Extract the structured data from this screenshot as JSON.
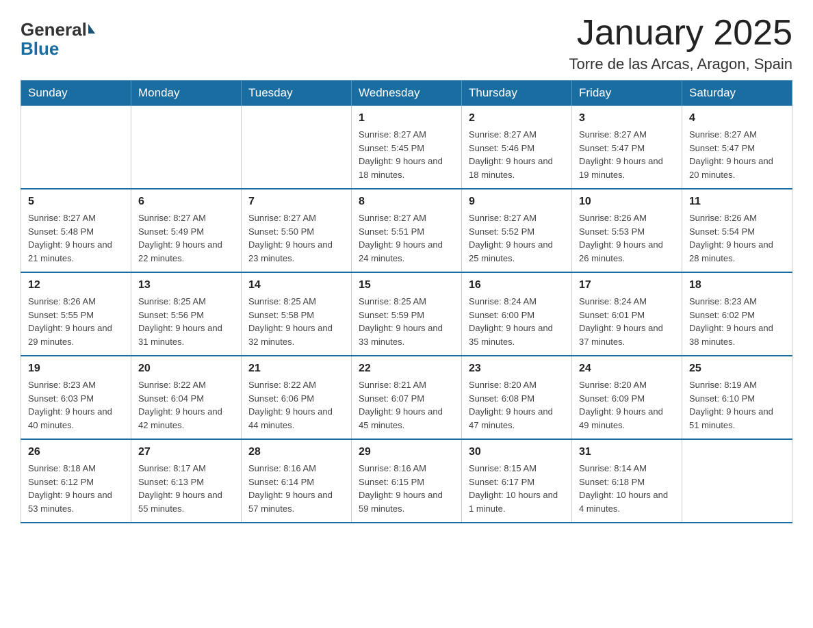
{
  "header": {
    "logo": {
      "general": "General",
      "blue": "Blue"
    },
    "title": "January 2025",
    "subtitle": "Torre de las Arcas, Aragon, Spain"
  },
  "calendar": {
    "weekdays": [
      "Sunday",
      "Monday",
      "Tuesday",
      "Wednesday",
      "Thursday",
      "Friday",
      "Saturday"
    ],
    "weeks": [
      [
        {
          "day": "",
          "info": ""
        },
        {
          "day": "",
          "info": ""
        },
        {
          "day": "",
          "info": ""
        },
        {
          "day": "1",
          "info": "Sunrise: 8:27 AM\nSunset: 5:45 PM\nDaylight: 9 hours and 18 minutes."
        },
        {
          "day": "2",
          "info": "Sunrise: 8:27 AM\nSunset: 5:46 PM\nDaylight: 9 hours and 18 minutes."
        },
        {
          "day": "3",
          "info": "Sunrise: 8:27 AM\nSunset: 5:47 PM\nDaylight: 9 hours and 19 minutes."
        },
        {
          "day": "4",
          "info": "Sunrise: 8:27 AM\nSunset: 5:47 PM\nDaylight: 9 hours and 20 minutes."
        }
      ],
      [
        {
          "day": "5",
          "info": "Sunrise: 8:27 AM\nSunset: 5:48 PM\nDaylight: 9 hours and 21 minutes."
        },
        {
          "day": "6",
          "info": "Sunrise: 8:27 AM\nSunset: 5:49 PM\nDaylight: 9 hours and 22 minutes."
        },
        {
          "day": "7",
          "info": "Sunrise: 8:27 AM\nSunset: 5:50 PM\nDaylight: 9 hours and 23 minutes."
        },
        {
          "day": "8",
          "info": "Sunrise: 8:27 AM\nSunset: 5:51 PM\nDaylight: 9 hours and 24 minutes."
        },
        {
          "day": "9",
          "info": "Sunrise: 8:27 AM\nSunset: 5:52 PM\nDaylight: 9 hours and 25 minutes."
        },
        {
          "day": "10",
          "info": "Sunrise: 8:26 AM\nSunset: 5:53 PM\nDaylight: 9 hours and 26 minutes."
        },
        {
          "day": "11",
          "info": "Sunrise: 8:26 AM\nSunset: 5:54 PM\nDaylight: 9 hours and 28 minutes."
        }
      ],
      [
        {
          "day": "12",
          "info": "Sunrise: 8:26 AM\nSunset: 5:55 PM\nDaylight: 9 hours and 29 minutes."
        },
        {
          "day": "13",
          "info": "Sunrise: 8:25 AM\nSunset: 5:56 PM\nDaylight: 9 hours and 31 minutes."
        },
        {
          "day": "14",
          "info": "Sunrise: 8:25 AM\nSunset: 5:58 PM\nDaylight: 9 hours and 32 minutes."
        },
        {
          "day": "15",
          "info": "Sunrise: 8:25 AM\nSunset: 5:59 PM\nDaylight: 9 hours and 33 minutes."
        },
        {
          "day": "16",
          "info": "Sunrise: 8:24 AM\nSunset: 6:00 PM\nDaylight: 9 hours and 35 minutes."
        },
        {
          "day": "17",
          "info": "Sunrise: 8:24 AM\nSunset: 6:01 PM\nDaylight: 9 hours and 37 minutes."
        },
        {
          "day": "18",
          "info": "Sunrise: 8:23 AM\nSunset: 6:02 PM\nDaylight: 9 hours and 38 minutes."
        }
      ],
      [
        {
          "day": "19",
          "info": "Sunrise: 8:23 AM\nSunset: 6:03 PM\nDaylight: 9 hours and 40 minutes."
        },
        {
          "day": "20",
          "info": "Sunrise: 8:22 AM\nSunset: 6:04 PM\nDaylight: 9 hours and 42 minutes."
        },
        {
          "day": "21",
          "info": "Sunrise: 8:22 AM\nSunset: 6:06 PM\nDaylight: 9 hours and 44 minutes."
        },
        {
          "day": "22",
          "info": "Sunrise: 8:21 AM\nSunset: 6:07 PM\nDaylight: 9 hours and 45 minutes."
        },
        {
          "day": "23",
          "info": "Sunrise: 8:20 AM\nSunset: 6:08 PM\nDaylight: 9 hours and 47 minutes."
        },
        {
          "day": "24",
          "info": "Sunrise: 8:20 AM\nSunset: 6:09 PM\nDaylight: 9 hours and 49 minutes."
        },
        {
          "day": "25",
          "info": "Sunrise: 8:19 AM\nSunset: 6:10 PM\nDaylight: 9 hours and 51 minutes."
        }
      ],
      [
        {
          "day": "26",
          "info": "Sunrise: 8:18 AM\nSunset: 6:12 PM\nDaylight: 9 hours and 53 minutes."
        },
        {
          "day": "27",
          "info": "Sunrise: 8:17 AM\nSunset: 6:13 PM\nDaylight: 9 hours and 55 minutes."
        },
        {
          "day": "28",
          "info": "Sunrise: 8:16 AM\nSunset: 6:14 PM\nDaylight: 9 hours and 57 minutes."
        },
        {
          "day": "29",
          "info": "Sunrise: 8:16 AM\nSunset: 6:15 PM\nDaylight: 9 hours and 59 minutes."
        },
        {
          "day": "30",
          "info": "Sunrise: 8:15 AM\nSunset: 6:17 PM\nDaylight: 10 hours and 1 minute."
        },
        {
          "day": "31",
          "info": "Sunrise: 8:14 AM\nSunset: 6:18 PM\nDaylight: 10 hours and 4 minutes."
        },
        {
          "day": "",
          "info": ""
        }
      ]
    ]
  }
}
